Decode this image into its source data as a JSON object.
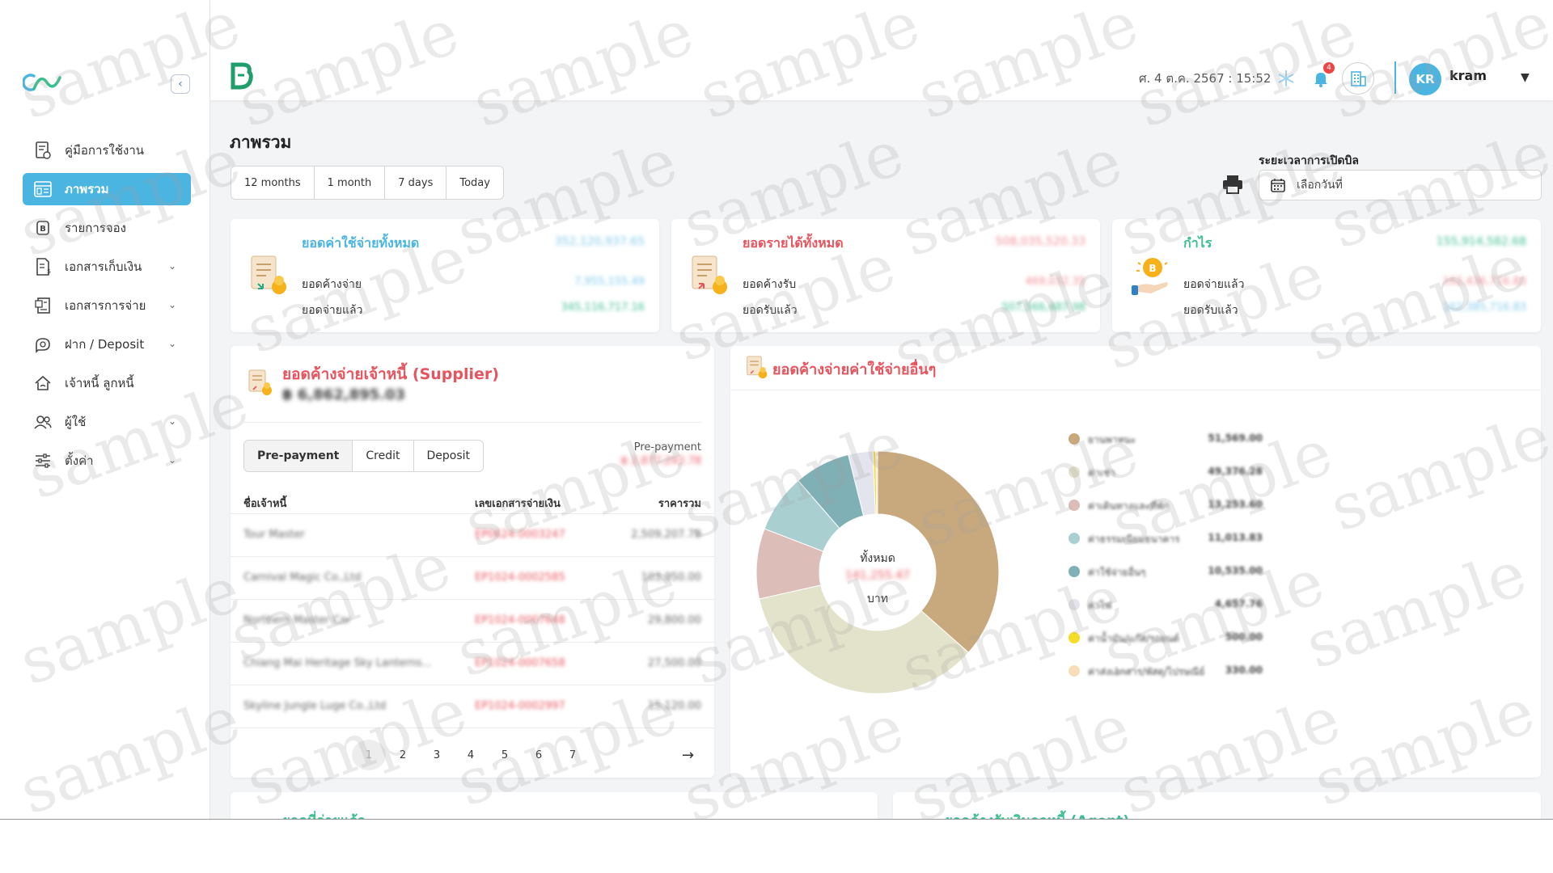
{
  "header": {
    "datetime": "ศ. 4 ต.ค. 2567 : 15:52",
    "notification_count": "4",
    "avatar_initials": "KR",
    "username": "kram"
  },
  "sidebar": {
    "items": [
      {
        "label": "คู่มือการใช้งาน",
        "icon": "manual-icon",
        "has_submenu": false,
        "active": false
      },
      {
        "label": "ภาพรวม",
        "icon": "dashboard-icon",
        "has_submenu": false,
        "active": true
      },
      {
        "label": "รายการจอง",
        "icon": "booking-icon",
        "has_submenu": false,
        "active": false
      },
      {
        "label": "เอกสารเก็บเงิน",
        "icon": "invoice-icon",
        "has_submenu": true,
        "active": false
      },
      {
        "label": "เอกสารการจ่าย",
        "icon": "payment-doc-icon",
        "has_submenu": true,
        "active": false
      },
      {
        "label": "ฝาก / Deposit",
        "icon": "deposit-icon",
        "has_submenu": true,
        "active": false
      },
      {
        "label": "เจ้าหนี้ ลูกหนี้",
        "icon": "creditor-icon",
        "has_submenu": false,
        "active": false
      },
      {
        "label": "ผู้ใช้",
        "icon": "users-icon",
        "has_submenu": true,
        "active": false
      },
      {
        "label": "ตั้งค่า",
        "icon": "settings-icon",
        "has_submenu": true,
        "active": false
      }
    ]
  },
  "main": {
    "title": "ภาพรวม",
    "range_tabs": [
      "12 months",
      "1 month",
      "7 days",
      "Today"
    ],
    "bill_period_label": "ระยะเวลาการเปิดบิล",
    "date_placeholder": "เลือกวันที่"
  },
  "summary_cards": [
    {
      "title": "ยอดค่าใช้จ่ายทั้งหมด",
      "title_color": "#4bb5e2",
      "total": "352,120,937.65",
      "total_color": "#7ec9ec",
      "rows": [
        {
          "label": "ยอดค้างจ่าย",
          "value": "7,955,155.49",
          "color": "#7ec9ec"
        },
        {
          "label": "ยอดจ่ายแล้ว",
          "value": "345,116,717.16",
          "color": "#3cbf8f"
        }
      ]
    },
    {
      "title": "ยอดรายได้ทั้งหมด",
      "title_color": "#e8545d",
      "total": "508,035,520.33",
      "total_color": "#f08a90",
      "rows": [
        {
          "label": "ยอดค้างรับ",
          "value": "469,032.35",
          "color": "#f08a90"
        },
        {
          "label": "ยอดรับแล้ว",
          "value": "507,566,487.98",
          "color": "#3cbf8f"
        }
      ]
    },
    {
      "title": "กำไร",
      "title_color": "#3cbf8f",
      "total": "155,914,582.68",
      "total_color": "#3cbf8f",
      "rows": [
        {
          "label": "ยอดจ่ายแล้ว",
          "value": "162,436,716.83",
          "color": "#f08a90"
        },
        {
          "label": "ยอดรับแล้ว",
          "value": "162,385,716.83",
          "color": "#7ec9ec"
        }
      ]
    }
  ],
  "supplier_panel": {
    "title": "ยอดค้างจ่ายเจ้าหนี้ (Supplier)",
    "total": "฿ 6,862,895.03",
    "tabs": [
      "Pre-payment",
      "Credit",
      "Deposit"
    ],
    "active_tab": "Pre-payment",
    "subtotal_label": "Pre-payment",
    "subtotal_value": "฿ 2,877,243.78",
    "columns": [
      "ชื่อเจ้าหนี้",
      "เลขเอกสารจ่ายเงิน",
      "ราคารวม"
    ],
    "rows": [
      [
        "Tour Master",
        "EP0624-0003247",
        "2,509,207.78"
      ],
      [
        "Carnival Magic Co.,Ltd",
        "EP1024-0002585",
        "103,950.00"
      ],
      [
        "Northern Master Car",
        "EP1024-0007648",
        "29,800.00"
      ],
      [
        "Chiang Mai Heritage Sky Lanterns...",
        "EP1024-0007658",
        "27,500.00"
      ],
      [
        "Skyline Jungle Luge Co.,Ltd",
        "EP1024-0002997",
        "15,120.00"
      ]
    ],
    "pages": [
      "1",
      "2",
      "3",
      "4",
      "5",
      "6",
      "7"
    ],
    "current_page": "1"
  },
  "expense_panel": {
    "title": "ยอดค้างจ่ายค่าใช้จ่ายอื่นๆ",
    "center_label": "ทั้งหมด",
    "center_value": "141,255.47",
    "center_unit": "บาท"
  },
  "chart_data": {
    "type": "pie",
    "categories": [
      "ยานพาหนะ",
      "ค่าเช่า",
      "ค่าเดินทางและที่พัก",
      "ค่าธรรมเนียมธนาคาร",
      "ค่าใช้จ่ายอื่นๆ",
      "ค่าไฟ",
      "ค่าน้ำมัน/แก๊ส/รถยนต์",
      "ค่าส่งเอกสาร/พัสดุ/ไปรษณีย์"
    ],
    "values": [
      51569.0,
      49376.28,
      13253.6,
      11013.83,
      10535.0,
      4657.76,
      500.0,
      330.0
    ],
    "value_labels": [
      "51,569.00",
      "49,376.28",
      "13,253.60",
      "11,013.83",
      "10,535.00",
      "4,657.76",
      "500.00",
      "330.00"
    ],
    "colors": [
      "#c8a97e",
      "#e3e3cb",
      "#dcbdb8",
      "#a9cfd1",
      "#7fb0b5",
      "#e4e4ee",
      "#f5dd2a",
      "#f7ddb9"
    ],
    "title": "ยอดค้างจ่ายค่าใช้จ่ายอื่นๆ",
    "legend": "right"
  },
  "bottom_panels": [
    {
      "title": "ยอดที่จ่ายแล้ว"
    },
    {
      "title": "ยอดค้างรับเงินลูกหนี้ (Agent)"
    }
  ],
  "watermark_text": "sample"
}
